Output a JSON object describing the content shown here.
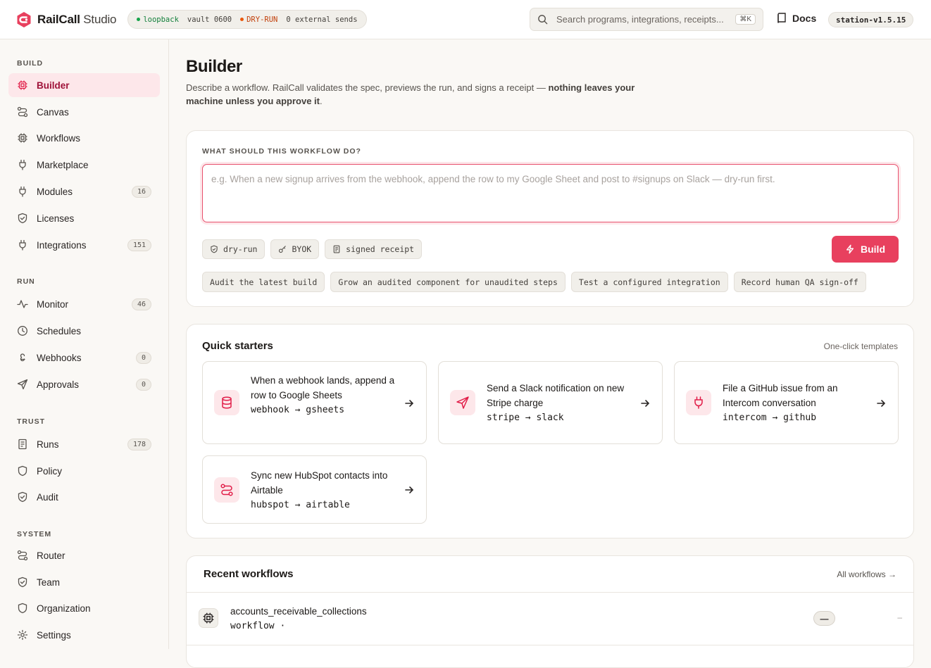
{
  "app": {
    "brand_bold": "RailCall",
    "brand_light": "Studio",
    "brand_color": "#e8405e"
  },
  "status": {
    "loopback": "loopback",
    "vault": "vault 0600",
    "mode": "DRY-RUN",
    "sends": "0 external sends"
  },
  "search": {
    "placeholder": "Search programs, integrations, receipts...",
    "shortcut": "⌘K"
  },
  "header": {
    "docs_label": "Docs",
    "version": "station-v1.5.15"
  },
  "sidebar": {
    "sections": {
      "build": "BUILD",
      "run": "RUN",
      "trust": "TRUST",
      "system": "SYSTEM"
    },
    "items": [
      {
        "label": "Builder",
        "icon": "cpu-icon",
        "active": true
      },
      {
        "label": "Canvas",
        "icon": "route-icon"
      },
      {
        "label": "Workflows",
        "icon": "cpu-icon"
      },
      {
        "label": "Marketplace",
        "icon": "plug-icon"
      },
      {
        "label": "Modules",
        "icon": "plug-icon",
        "badge": "16"
      },
      {
        "label": "Licenses",
        "icon": "shield-check-icon"
      },
      {
        "label": "Integrations",
        "icon": "plug-icon",
        "badge": "151"
      },
      {
        "label": "Monitor",
        "icon": "activity-icon",
        "badge": "46"
      },
      {
        "label": "Schedules",
        "icon": "clock-icon"
      },
      {
        "label": "Webhooks",
        "icon": "webhook-icon",
        "badge": "0"
      },
      {
        "label": "Approvals",
        "icon": "send-icon",
        "badge": "0"
      },
      {
        "label": "Runs",
        "icon": "receipt-icon",
        "badge": "178"
      },
      {
        "label": "Policy",
        "icon": "shield-icon"
      },
      {
        "label": "Audit",
        "icon": "shield-check-icon"
      },
      {
        "label": "Router",
        "icon": "route-icon"
      },
      {
        "label": "Team",
        "icon": "shield-check-icon"
      },
      {
        "label": "Organization",
        "icon": "shield-icon"
      },
      {
        "label": "Settings",
        "icon": "gear-icon"
      }
    ]
  },
  "page": {
    "title": "Builder",
    "desc_plain": "Describe a workflow. RailCall validates the spec, previews the run, and signs a receipt — ",
    "desc_bold": "nothing leaves your machine unless you approve it",
    "desc_end": "."
  },
  "prompt": {
    "label": "WHAT SHOULD THIS WORKFLOW DO?",
    "placeholder": "e.g. When a new signup arrives from the webhook, append the row to my Google Sheet and post to #signups on Slack — dry-run first.",
    "chips": [
      "dry-run",
      "BYOK",
      "signed receipt"
    ],
    "build_label": "Build",
    "suggestions": [
      "Audit the latest build",
      "Grow an audited component for unaudited steps",
      "Test a configured integration",
      "Record human QA sign-off"
    ]
  },
  "starters": {
    "title": "Quick starters",
    "aside": "One-click templates",
    "items": [
      {
        "text": "When a webhook lands, append a row to Google Sheets",
        "flow": "webhook → gsheets",
        "icon": "database-icon"
      },
      {
        "text": "Send a Slack notification on new Stripe charge",
        "flow": "stripe → slack",
        "icon": "send-icon"
      },
      {
        "text": "File a GitHub issue from an Intercom conversation",
        "flow": "intercom → github",
        "icon": "plug-icon"
      },
      {
        "text": "Sync new HubSpot contacts into Airtable",
        "flow": "hubspot → airtable",
        "icon": "route-icon"
      }
    ]
  },
  "recent": {
    "title": "Recent workflows",
    "link": "All workflows →",
    "rows": [
      {
        "name": "accounts_receivable_collections",
        "type": "workflow ·",
        "status": "—",
        "time": "–"
      }
    ]
  }
}
